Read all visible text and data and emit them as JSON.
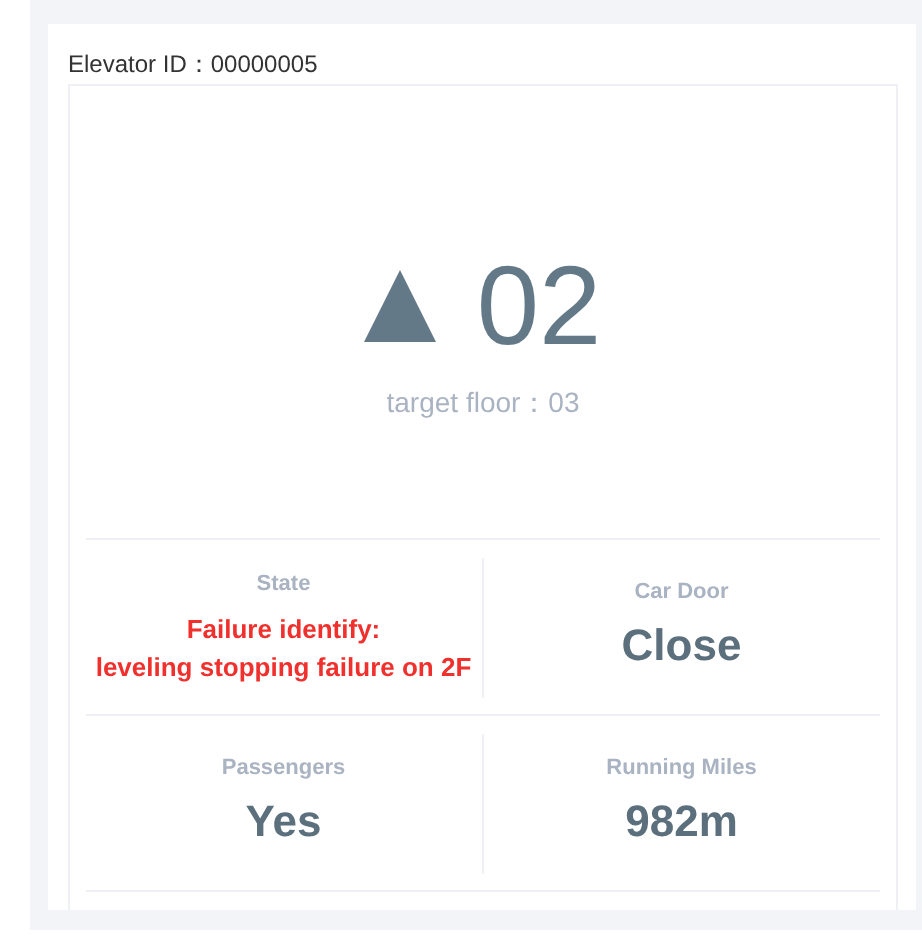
{
  "card": {
    "title": "Elevator ID：00000005"
  },
  "display": {
    "going_up": true,
    "floor": "02",
    "target": "target floor：03"
  },
  "stats": [
    {
      "label": "State",
      "value": "Failure identify:\nleveling stopping failure on 2F",
      "alert": true
    },
    {
      "label": "Car Door",
      "value": "Close",
      "alert": false
    },
    {
      "label": "Passengers",
      "value": "Yes",
      "alert": false
    },
    {
      "label": "Running Miles",
      "value": "982m",
      "alert": false
    }
  ]
}
